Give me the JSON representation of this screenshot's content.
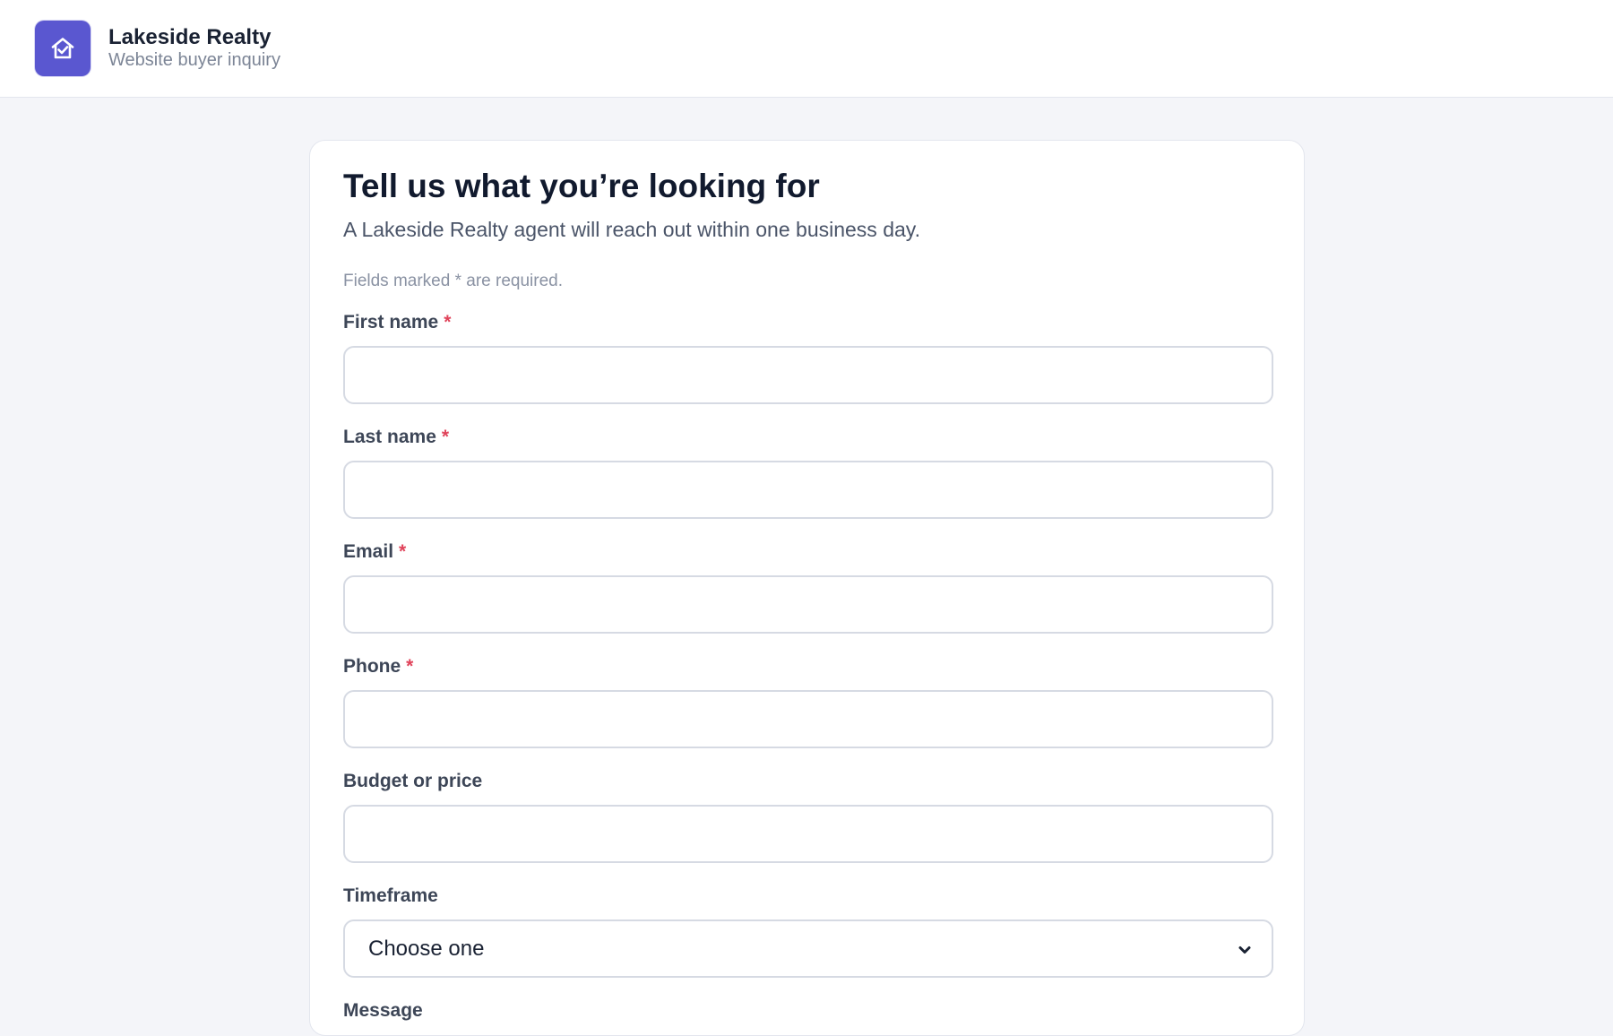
{
  "header": {
    "brand_name": "Lakeside Realty",
    "brand_subtitle": "Website buyer inquiry",
    "logo_icon": "house-check-icon",
    "accent_color": "#5a57d0"
  },
  "form": {
    "title": "Tell us what you’re looking for",
    "subtitle": "A Lakeside Realty agent will reach out within one business day.",
    "required_note": "Fields marked * are required.",
    "required_marker": "*",
    "fields": {
      "first_name": {
        "label": "First name",
        "required": true,
        "value": ""
      },
      "last_name": {
        "label": "Last name",
        "required": true,
        "value": ""
      },
      "email": {
        "label": "Email",
        "required": true,
        "value": ""
      },
      "phone": {
        "label": "Phone",
        "required": true,
        "value": ""
      },
      "budget": {
        "label": "Budget or price",
        "required": false,
        "value": ""
      },
      "timeframe": {
        "label": "Timeframe",
        "required": false,
        "selected": "Choose one"
      },
      "message": {
        "label": "Message",
        "required": false
      }
    }
  }
}
